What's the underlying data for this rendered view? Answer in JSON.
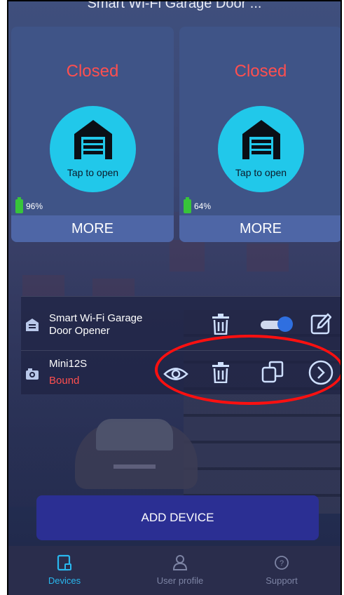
{
  "header": {
    "title": "Smart Wi-Fi Garage Door ..."
  },
  "cards": [
    {
      "status": "Closed",
      "tap_label": "Tap to open",
      "battery": "96%",
      "more_label": "MORE"
    },
    {
      "status": "Closed",
      "tap_label": "Tap to open",
      "battery": "64%",
      "more_label": "MORE"
    }
  ],
  "devices": [
    {
      "name": "Smart Wi-Fi Garage Door Opener",
      "icon": "garage-device-icon",
      "toggle_on": true
    },
    {
      "name": "Mini12S",
      "status": "Bound",
      "icon": "camera-icon"
    }
  ],
  "add_device_label": "ADD DEVICE",
  "nav": [
    {
      "label": "Devices",
      "icon": "devices-icon",
      "active": true
    },
    {
      "label": "User profile",
      "icon": "user-icon",
      "active": false
    },
    {
      "label": "Support",
      "icon": "help-icon",
      "active": false
    }
  ],
  "colors": {
    "status_red": "#ff4f4f",
    "circle_cyan": "#21c8ea",
    "accent_blue": "#29b8ef",
    "add_button": "#2b2f93",
    "annotation_red": "#ff1010"
  }
}
